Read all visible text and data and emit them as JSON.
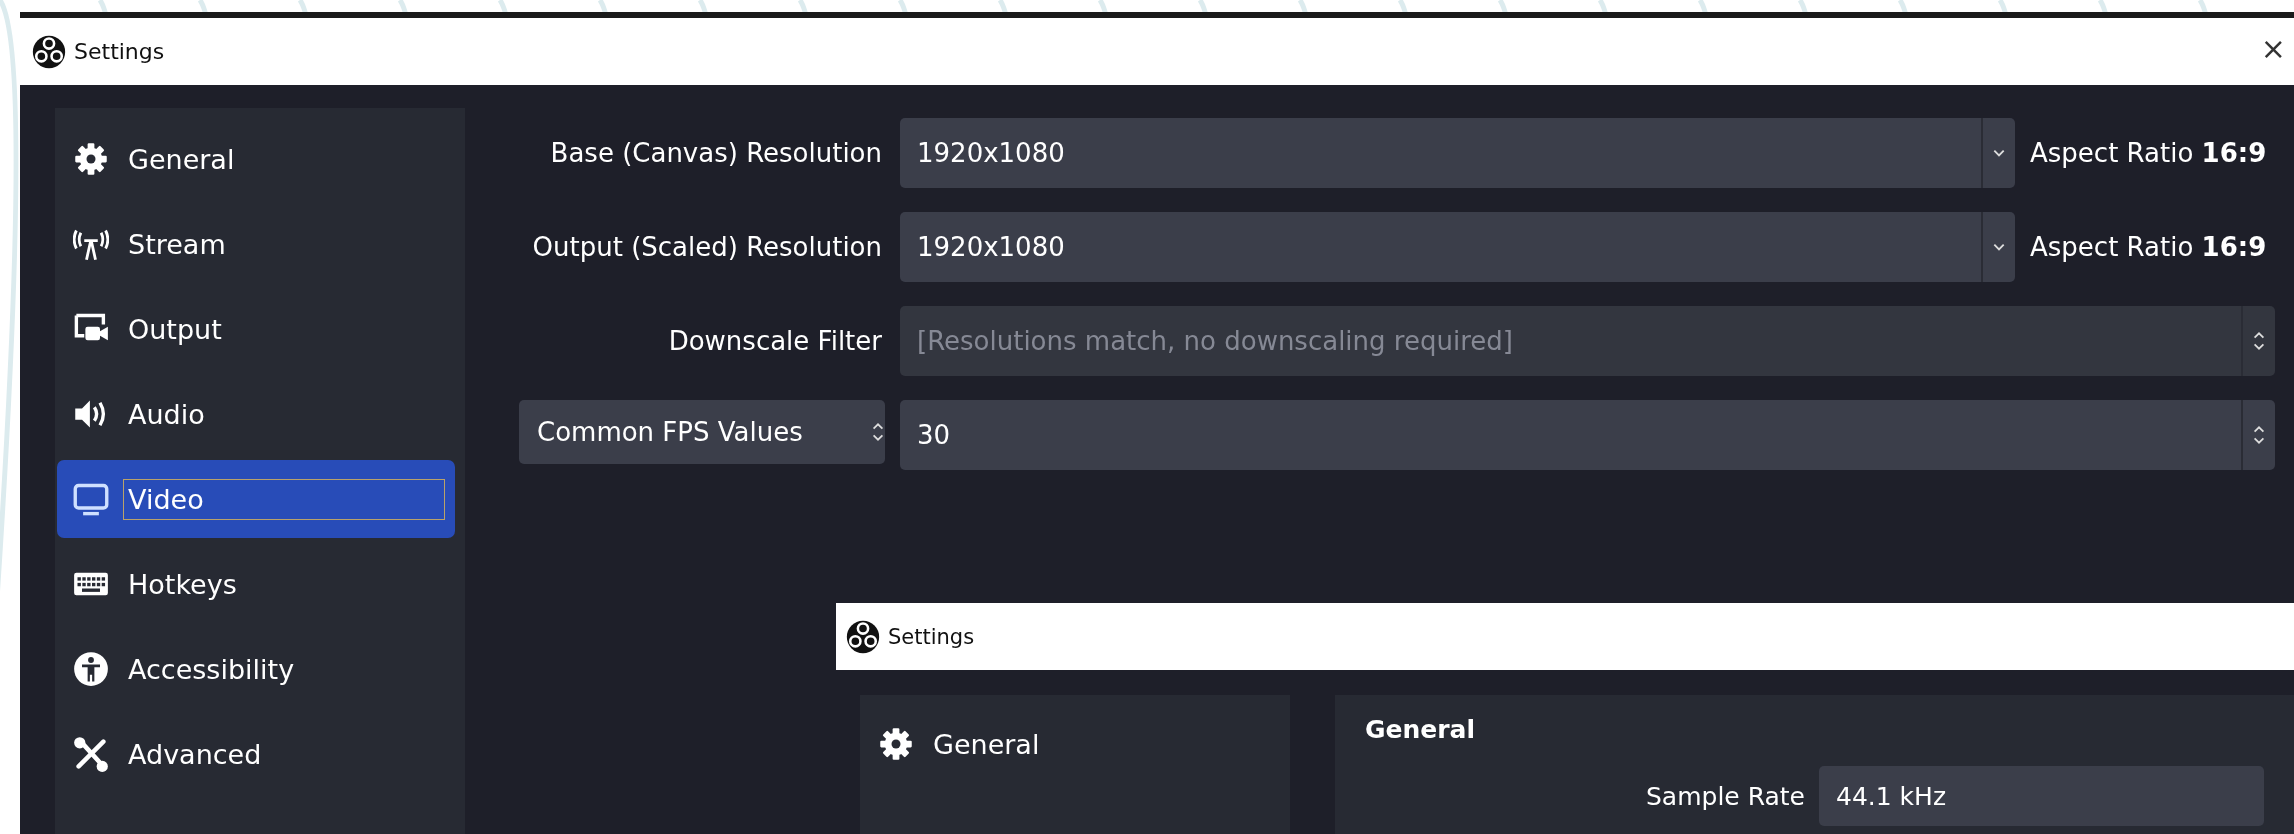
{
  "window": {
    "title": "Settings",
    "close": "×"
  },
  "sidebar": {
    "items": [
      {
        "label": "General",
        "selected": false
      },
      {
        "label": "Stream",
        "selected": false
      },
      {
        "label": "Output",
        "selected": false
      },
      {
        "label": "Audio",
        "selected": false
      },
      {
        "label": "Video",
        "selected": true
      },
      {
        "label": "Hotkeys",
        "selected": false
      },
      {
        "label": "Accessibility",
        "selected": false
      },
      {
        "label": "Advanced",
        "selected": false
      }
    ]
  },
  "video": {
    "rows": [
      {
        "kind": "dropdown",
        "label": "Base (Canvas) Resolution",
        "value": "1920x1080",
        "disabled": false,
        "aspect": "Aspect Ratio **16:9**"
      },
      {
        "kind": "dropdown",
        "label": "Output (Scaled) Resolution",
        "value": "1920x1080",
        "disabled": false,
        "aspect": "Aspect Ratio **16:9**"
      },
      {
        "kind": "spin",
        "label": "Downscale Filter",
        "value": "[Resolutions match, no downscaling required]",
        "disabled": true
      },
      {
        "kind": "spin",
        "label_combo": "Common FPS Values",
        "value": "30",
        "disabled": false
      }
    ]
  },
  "second_window": {
    "title": "Settings",
    "sidebar": {
      "items": [
        {
          "label": "General",
          "selected": false
        }
      ]
    },
    "section_title": "General",
    "fields": [
      {
        "label": "Sample Rate",
        "value": "44.1 kHz"
      }
    ]
  }
}
